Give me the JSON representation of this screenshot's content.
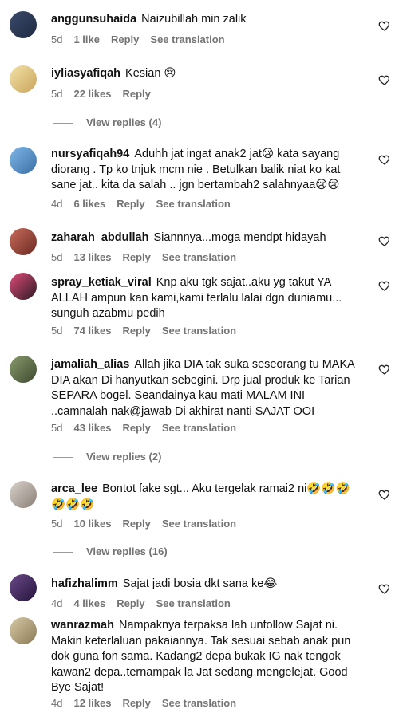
{
  "comments": [
    {
      "username": "anggunsuhaida",
      "text": "Naizubillah min zalik",
      "time": "5d",
      "likes": "1 like",
      "reply": "Reply",
      "translate": "See translation"
    },
    {
      "username": "iyliasyafiqah",
      "text": "Kesian 😢",
      "time": "5d",
      "likes": "22 likes",
      "reply": "Reply",
      "replies": "View replies (4)"
    },
    {
      "username": "nursyafiqah94",
      "text": "Aduhh jat ingat anak2 jat😢 kata sayang diorang . Tp ko tnjuk mcm nie . Betulkan balik niat ko kat sane jat.. kita da salah .. jgn bertambah2 salahnyaa😢😢",
      "time": "4d",
      "likes": "6 likes",
      "reply": "Reply",
      "translate": "See translation"
    },
    {
      "username": "zaharah_abdullah",
      "text": "Siannnya...moga mendpt hidayah",
      "time": "5d",
      "likes": "13 likes",
      "reply": "Reply",
      "translate": "See translation"
    },
    {
      "username": "spray_ketiak_viral",
      "text": "Knp aku tgk sajat..aku yg takut YA ALLAH ampun kan kami,kami terlalu lalai dgn duniamu... sunguh azabmu pedih",
      "time": "5d",
      "likes": "74 likes",
      "reply": "Reply",
      "translate": "See translation"
    },
    {
      "username": "jamaliah_alias",
      "text": "Allah jika DIA tak suka seseorang tu MAKA DIA akan Di hanyutkan sebegini. Drp jual produk ke Tarian SEPARA bogel. Seandainya kau mati MALAM INI ..camnalah nak@jawab Di akhirat nanti SAJAT OOI",
      "time": "5d",
      "likes": "43 likes",
      "reply": "Reply",
      "translate": "See translation",
      "replies": "View replies (2)"
    },
    {
      "username": "arca_lee",
      "text": "Bontot fake sgt... Aku tergelak ramai2 ni🤣🤣🤣🤣🤣🤣",
      "time": "5d",
      "likes": "10 likes",
      "reply": "Reply",
      "translate": "See translation",
      "replies": "View replies (16)"
    },
    {
      "username": "hafizhalimm",
      "text": "Sajat jadi bosia dkt sana ke😂",
      "time": "4d",
      "likes": "4 likes",
      "reply": "Reply",
      "translate": "See translation"
    },
    {
      "username": "wanrazmah",
      "text": "Nampaknya terpaksa lah unfollow Sajat ni. Makin keterlaluan pakaiannya. Tak sesuai sebab anak pun dok guna fon sama. Kadang2 depa bukak IG nak tengok kawan2 depa..ternampak la Jat sedang mengelejat. Good Bye Sajat!",
      "time": "4d",
      "likes": "12 likes",
      "reply": "Reply",
      "translate": "See translation"
    }
  ],
  "colors": {
    "meta": "#737373",
    "text": "#111111",
    "divider": "#dbdbdb"
  }
}
